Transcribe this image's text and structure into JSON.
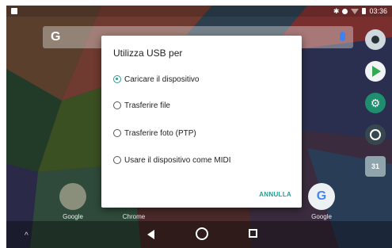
{
  "status": {
    "time": "03:36",
    "icons": [
      "bluetooth-icon",
      "dnd-icon",
      "wifi-icon",
      "battery-icon"
    ]
  },
  "search": {
    "logo": "G"
  },
  "home": {
    "app_labels": [
      "Google",
      "Chrome",
      "Google"
    ]
  },
  "dialog": {
    "title": "Utilizza USB per",
    "options": [
      {
        "label": "Caricare il dispositivo",
        "selected": true
      },
      {
        "label": "Trasferire file",
        "selected": false
      },
      {
        "label": "Trasferire foto (PTP)",
        "selected": false
      },
      {
        "label": "Usare il dispositivo come MIDI",
        "selected": false
      }
    ],
    "cancel_label": "ANNULLA"
  },
  "colors": {
    "accent": "#2a9d8f"
  }
}
